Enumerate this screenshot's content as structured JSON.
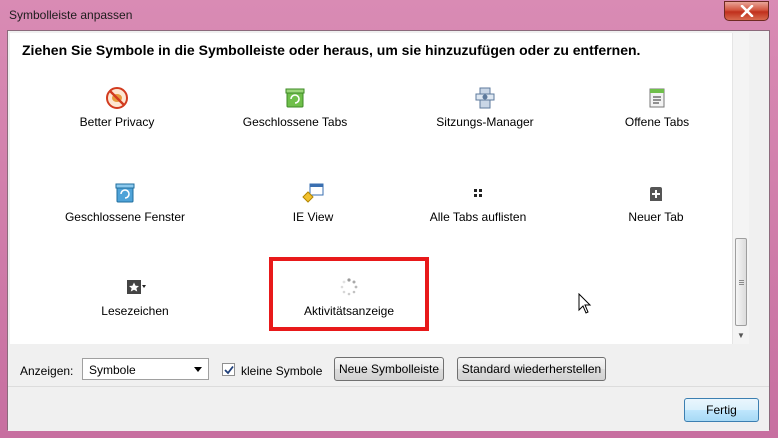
{
  "window": {
    "title": "Symbolleiste anpassen"
  },
  "panel": {
    "heading": "Ziehen Sie Symbole in die Symbolleiste oder heraus, um sie hinzuzufügen oder zu entfernen.",
    "items": [
      {
        "label": "Better Privacy",
        "icon": "better-privacy-icon"
      },
      {
        "label": "Geschlossene Tabs",
        "icon": "closed-tabs-icon"
      },
      {
        "label": "Sitzungs-Manager",
        "icon": "session-manager-icon"
      },
      {
        "label": "Offene Tabs",
        "icon": "open-tabs-icon"
      },
      {
        "label": "Geschlossene Fenster",
        "icon": "closed-windows-icon"
      },
      {
        "label": "IE View",
        "icon": "ie-view-icon"
      },
      {
        "label": "Alle Tabs auflisten",
        "icon": "list-all-tabs-icon"
      },
      {
        "label": "Neuer Tab",
        "icon": "new-tab-icon"
      },
      {
        "label": "Lesezeichen",
        "icon": "bookmarks-icon"
      },
      {
        "label": "Aktivitätsanzeige",
        "icon": "throbber-icon"
      }
    ]
  },
  "controls": {
    "show_label": "Anzeigen:",
    "show_value": "Symbole",
    "small_icons_label": "kleine Symbole",
    "small_icons_checked": true,
    "new_toolbar_label": "Neue Symbolleiste",
    "restore_label": "Standard wiederherstellen",
    "done_label": "Fertig"
  },
  "colors": {
    "highlight": "#e8191a",
    "close_button": "#c0301c"
  }
}
